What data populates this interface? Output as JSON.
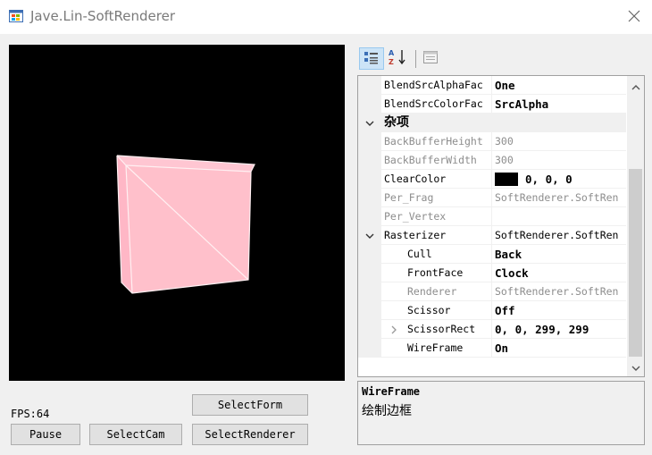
{
  "window": {
    "title": "Jave.Lin-SoftRenderer",
    "icon": "windows-form-icon",
    "close_icon": "close-icon"
  },
  "viewport": {
    "background": "#000000",
    "cube_color": "#ffc0cb",
    "edge_color": "#fff0f2"
  },
  "controls": {
    "fps_text": "FPS:64",
    "buttons": {
      "select_form": "SelectForm",
      "pause": "Pause",
      "select_cam": "SelectCam",
      "select_renderer": "SelectRenderer"
    }
  },
  "property_grid": {
    "toolbar": {
      "categorized_icon": "categorized-view-icon",
      "alphabetical_icon": "alphabetical-sort-icon",
      "property_pages_icon": "property-pages-icon"
    },
    "rows": [
      {
        "name": "BlendSrcAlphaFac",
        "value": "One"
      },
      {
        "name": "BlendSrcColorFac",
        "value": "SrcAlpha"
      },
      {
        "category": "杂项"
      },
      {
        "name": "BackBufferHeight",
        "value": "300"
      },
      {
        "name": "BackBufferWidth",
        "value": "300"
      },
      {
        "name": "ClearColor",
        "value": "0, 0, 0"
      },
      {
        "name": "Per_Frag",
        "value": "SoftRenderer.SoftRen"
      },
      {
        "name": "Per_Vertex",
        "value": ""
      },
      {
        "name": "Rasterizer",
        "value": "SoftRenderer.SoftRen"
      },
      {
        "name": "Cull",
        "value": "Back"
      },
      {
        "name": "FrontFace",
        "value": "Clock"
      },
      {
        "name": "Renderer",
        "value": "SoftRenderer.SoftRen"
      },
      {
        "name": "Scissor",
        "value": "Off"
      },
      {
        "name": "ScissorRect",
        "value": "0, 0, 299, 299"
      },
      {
        "name": "WireFrame",
        "value": "On"
      }
    ],
    "scrollbar": {
      "up_icon": "scroll-up-icon",
      "down_icon": "scroll-down-icon"
    }
  },
  "description": {
    "title": "WireFrame",
    "text": "绘制边框"
  }
}
